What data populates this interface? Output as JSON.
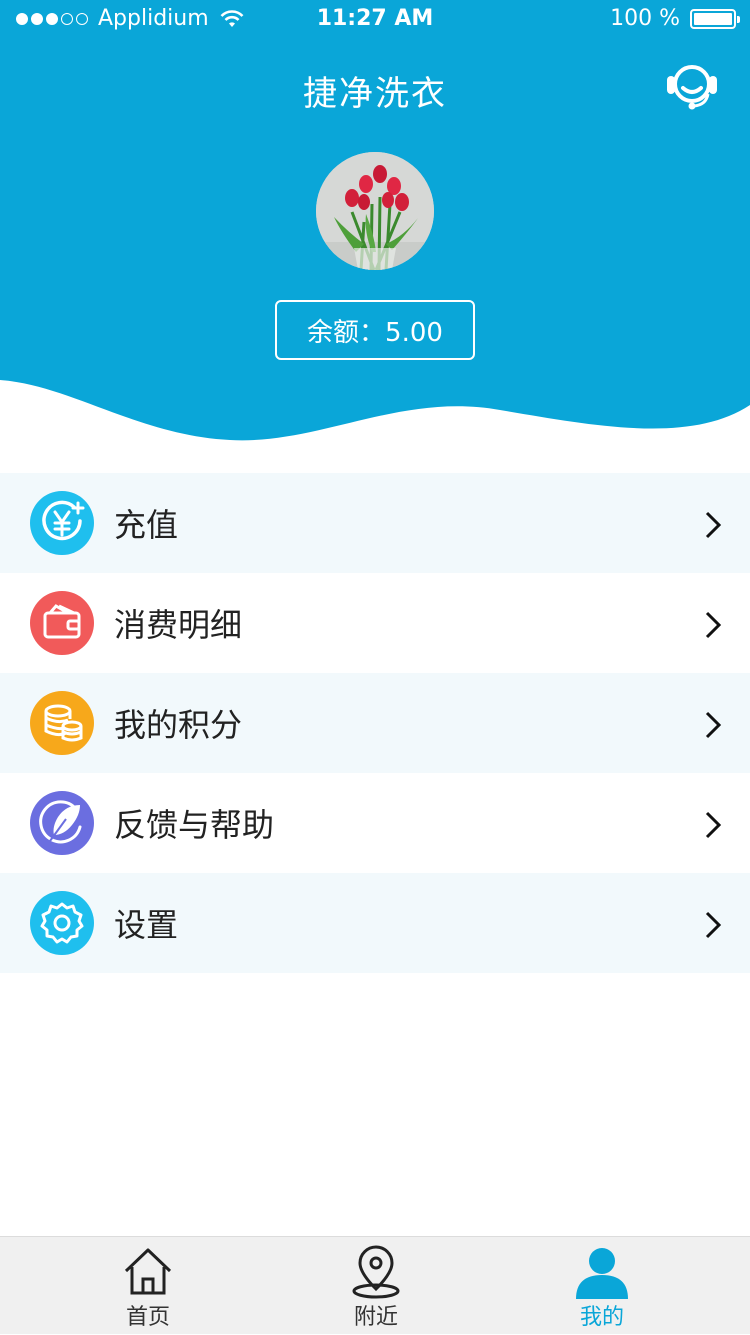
{
  "status_bar": {
    "carrier": "Applidium",
    "time": "11:27 AM",
    "battery": "100 %"
  },
  "header": {
    "title": "捷净洗衣",
    "balance_label": "余额：5.00",
    "service_icon": "headset-icon",
    "accent_color": "#0aa6d8"
  },
  "menu": {
    "items": [
      {
        "label": "充值",
        "icon": "yen-recharge-icon",
        "color": "#1fbfee"
      },
      {
        "label": "消费明细",
        "icon": "wallet-icon",
        "color": "#f15a5a"
      },
      {
        "label": "我的积分",
        "icon": "coins-icon",
        "color": "#f7a81b"
      },
      {
        "label": "反馈与帮助",
        "icon": "feather-icon",
        "color": "#6b6ee0"
      },
      {
        "label": "设置",
        "icon": "gear-icon",
        "color": "#1fbfee"
      }
    ]
  },
  "tabbar": {
    "tabs": [
      {
        "label": "首页",
        "icon": "home-icon"
      },
      {
        "label": "附近",
        "icon": "location-pin-icon"
      },
      {
        "label": "我的",
        "icon": "user-icon",
        "active": true
      }
    ]
  }
}
